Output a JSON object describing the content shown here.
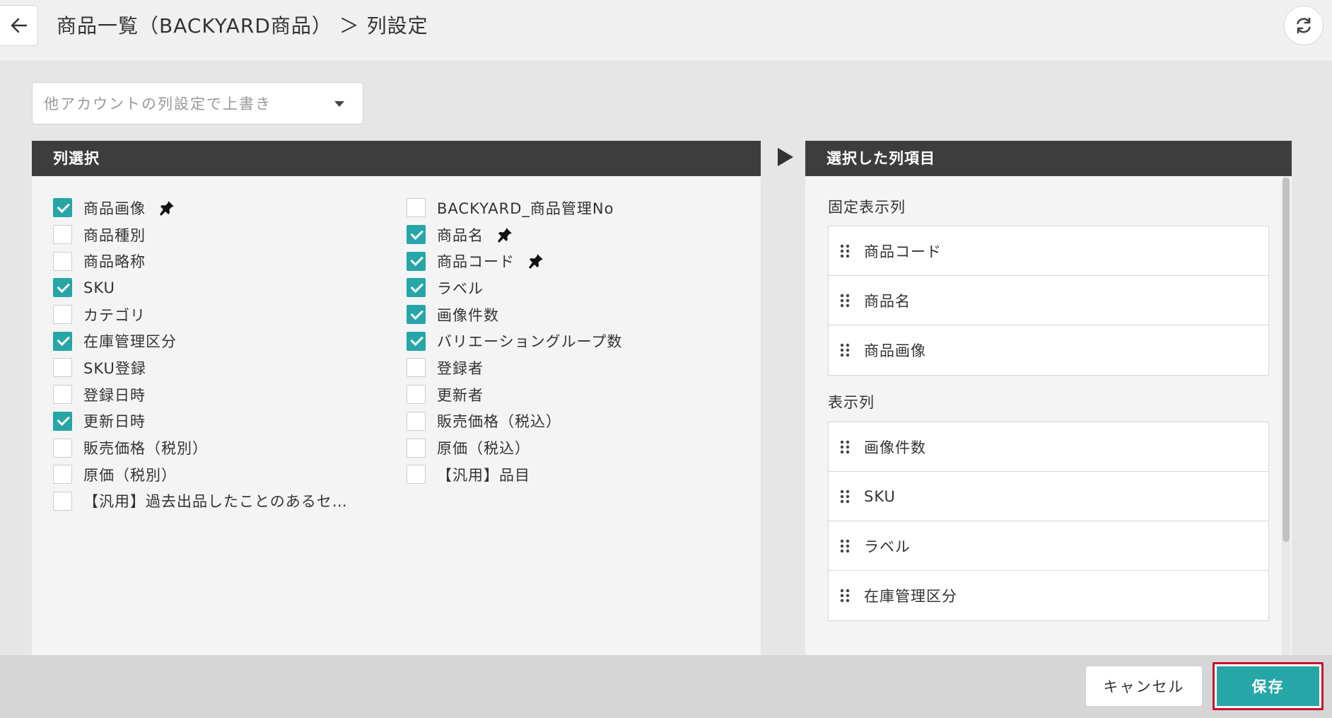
{
  "header": {
    "back_icon": "arrow-left-icon",
    "title": "商品一覧（BACKYARD商品） ＞ 列設定",
    "refresh_icon": "refresh-icon"
  },
  "override_select": {
    "placeholder": "他アカウントの列設定で上書き",
    "caret_icon": "chevron-down-icon"
  },
  "column_select": {
    "header": "列選択",
    "left_column": [
      {
        "label": "商品画像",
        "checked": true,
        "pinned": true
      },
      {
        "label": "商品種別",
        "checked": false,
        "pinned": false
      },
      {
        "label": "商品略称",
        "checked": false,
        "pinned": false
      },
      {
        "label": "SKU",
        "checked": true,
        "pinned": false
      },
      {
        "label": "カテゴリ",
        "checked": false,
        "pinned": false
      },
      {
        "label": "在庫管理区分",
        "checked": true,
        "pinned": false
      },
      {
        "label": "SKU登録",
        "checked": false,
        "pinned": false
      },
      {
        "label": "登録日時",
        "checked": false,
        "pinned": false
      },
      {
        "label": "更新日時",
        "checked": true,
        "pinned": false
      },
      {
        "label": "販売価格（税別）",
        "checked": false,
        "pinned": false
      },
      {
        "label": "原価（税別）",
        "checked": false,
        "pinned": false
      },
      {
        "label": "【汎用】過去出品したことのあるセ…",
        "checked": false,
        "pinned": false
      }
    ],
    "right_column": [
      {
        "label": "BACKYARD_商品管理No",
        "checked": false,
        "pinned": false
      },
      {
        "label": "商品名",
        "checked": true,
        "pinned": true
      },
      {
        "label": "商品コード",
        "checked": true,
        "pinned": true
      },
      {
        "label": "ラベル",
        "checked": true,
        "pinned": false
      },
      {
        "label": "画像件数",
        "checked": true,
        "pinned": false
      },
      {
        "label": "バリエーショングループ数",
        "checked": true,
        "pinned": false
      },
      {
        "label": "登録者",
        "checked": false,
        "pinned": false
      },
      {
        "label": "更新者",
        "checked": false,
        "pinned": false
      },
      {
        "label": "販売価格（税込）",
        "checked": false,
        "pinned": false
      },
      {
        "label": "原価（税込）",
        "checked": false,
        "pinned": false
      },
      {
        "label": "【汎用】品目",
        "checked": false,
        "pinned": false
      }
    ]
  },
  "selected_columns": {
    "header": "選択した列項目",
    "fixed_label": "固定表示列",
    "fixed": [
      "商品コード",
      "商品名",
      "商品画像"
    ],
    "display_label": "表示列",
    "display": [
      "画像件数",
      "SKU",
      "ラベル",
      "在庫管理区分"
    ]
  },
  "footer": {
    "cancel_label": "キャンセル",
    "save_label": "保存"
  },
  "colors": {
    "accent": "#26a6a6",
    "panel_header": "#3d3d3d",
    "highlight_border": "#c8102e"
  }
}
